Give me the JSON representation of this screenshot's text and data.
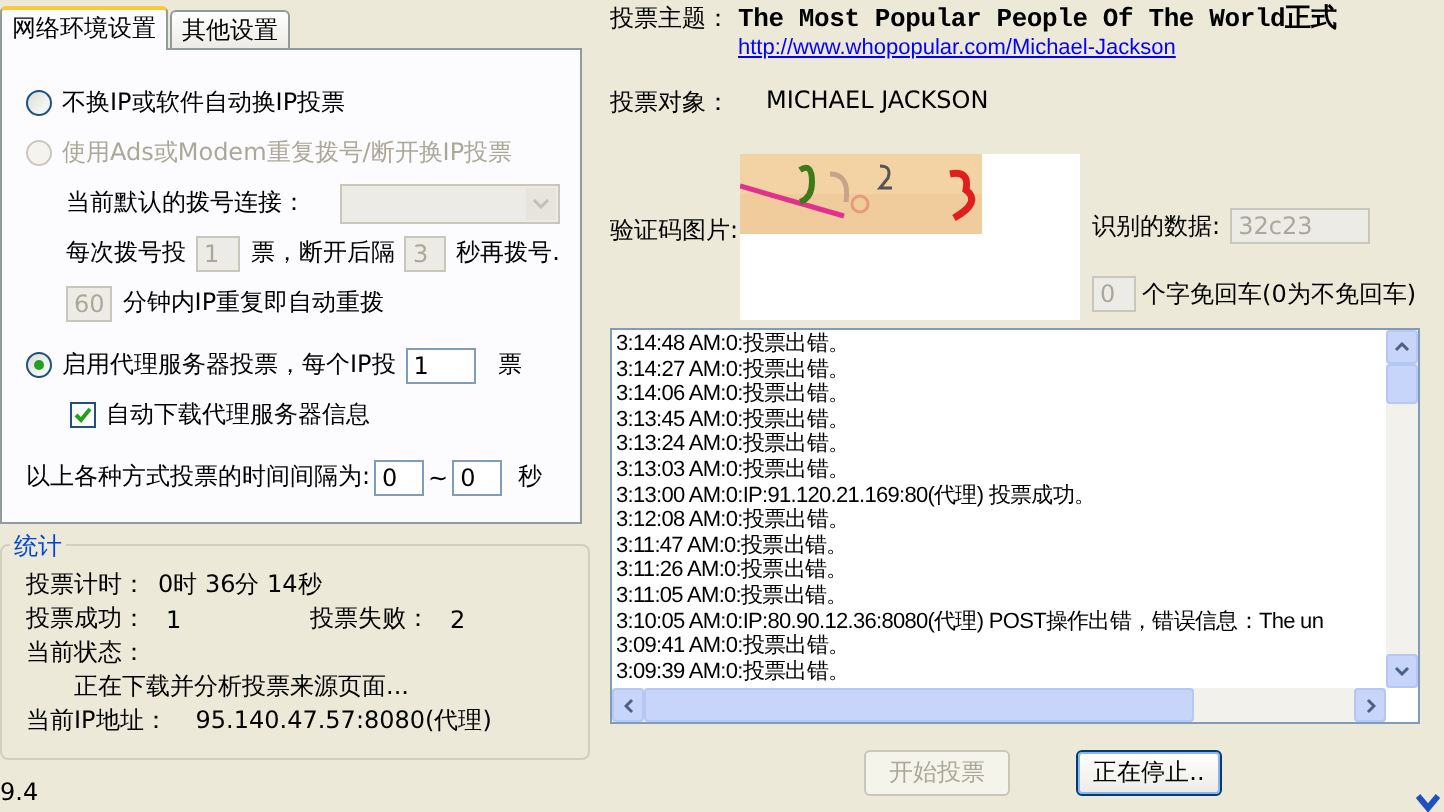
{
  "tabs": [
    {
      "label": "网络环境设置",
      "selected": true
    },
    {
      "label": "其他设置",
      "selected": false
    }
  ],
  "vote_modes": [
    {
      "kind": "plain",
      "label": "不换IP或软件自动换IP投票",
      "selected": false,
      "disabled": false
    },
    {
      "kind": "redial",
      "label": "使用Ads或Modem重复拨号/断开换IP投票",
      "selected": false,
      "disabled": true,
      "connection_label": "当前默认的拨号连接：",
      "votes_before": "每次拨号投",
      "votes_per_dial": "1",
      "votes_after": "票，断开后隔",
      "wait_seconds": "3",
      "wait_after": "秒再拨号.",
      "minutes": "60",
      "minutes_after": "分钟内IP重复即自动重拨"
    },
    {
      "kind": "proxy",
      "label": "启用代理服务器投票，每个IP投",
      "selected": true,
      "disabled": false,
      "votes": "1",
      "unit": "票",
      "auto_download": {
        "label": "自动下载代理服务器信息",
        "checked": true
      }
    }
  ],
  "interval": {
    "label": "以上各种方式投票的时间间隔为:",
    "from": "0",
    "separator": "~",
    "to": "0",
    "unit": "秒"
  },
  "stats": {
    "title": "统计",
    "timer_label": "投票计时：",
    "timer": "0时 36分 14秒",
    "success_label": "投票成功：",
    "success": "1",
    "fail_label": "投票失败：",
    "fail": "2",
    "status_label": "当前状态：",
    "status": "正在下载并分析投票来源页面...",
    "ip_label": "当前IP地址：",
    "ip": "95.140.47.57:8080(代理)"
  },
  "version": "9.4",
  "topic_label": "投票主题：",
  "topic": "The Most Popular People Of The World正式",
  "link": "http://www.whopopular.com/Michael-Jackson",
  "target_label": "投票对象：",
  "target": "MICHAEL JACKSON",
  "captcha_label": "验证码图片:",
  "recognized_label": "识别的数据:",
  "recognized": "32c23",
  "auto_enter": "0",
  "auto_enter_label": "个字免回车(0为不免回车)",
  "log": [
    "3:14:48 AM:0:投票出错。",
    "3:14:27 AM:0:投票出错。",
    "3:14:06 AM:0:投票出错。",
    "3:13:45 AM:0:投票出错。",
    "3:13:24 AM:0:投票出错。",
    "3:13:03 AM:0:投票出错。",
    "3:13:00 AM:0:IP:91.120.21.169:80(代理) 投票成功。",
    "3:12:08 AM:0:投票出错。",
    "3:11:47 AM:0:投票出错。",
    "3:11:26 AM:0:投票出错。",
    "3:11:05 AM:0:投票出错。",
    "3:10:05 AM:0:IP:80.90.12.36:8080(代理) POST操作出错，错误信息：The un",
    "3:09:41 AM:0:投票出错。",
    "3:09:39 AM:0:投票出错。"
  ],
  "buttons": [
    {
      "label": "开始投票",
      "disabled": true,
      "focused": false
    },
    {
      "label": "正在停止..",
      "disabled": false,
      "focused": true
    }
  ]
}
